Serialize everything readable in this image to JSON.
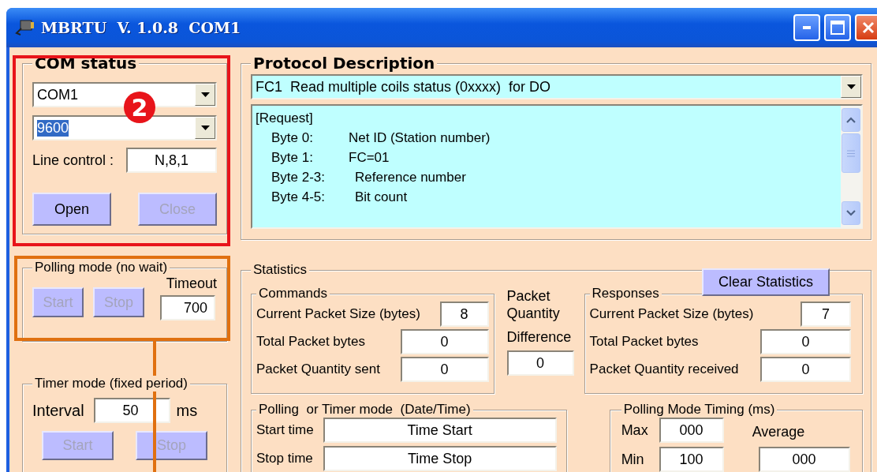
{
  "window": {
    "title": "MBRTU  V. 1.0.8  COM1"
  },
  "com_status": {
    "title": "COM status",
    "port": {
      "value": "COM1"
    },
    "baud": {
      "value": "9600",
      "text_selected": true
    },
    "line_control": {
      "label": "Line control :",
      "value": "N,8,1"
    },
    "buttons": [
      {
        "label": "Open",
        "disabled": false
      },
      {
        "label": "Close",
        "disabled": true
      }
    ]
  },
  "polling_mode": {
    "title": "Polling mode (no wait)",
    "buttons": [
      {
        "label": "Start",
        "disabled": true
      },
      {
        "label": "Stop",
        "disabled": true
      }
    ],
    "timeout": {
      "label": "Timeout",
      "value": "700"
    }
  },
  "timer_mode": {
    "title": "Timer mode (fixed period)",
    "interval": {
      "label": "Interval",
      "value": "50",
      "unit": "ms"
    },
    "buttons": [
      {
        "label": "Start",
        "disabled": true
      },
      {
        "label": "Stop",
        "disabled": true
      }
    ]
  },
  "protocol_description": {
    "title": "Protocol Description",
    "function_code": "FC1  Read multiple coils status (0xxxx)  for DO",
    "request_lines": [
      {
        "label": "[Request]"
      },
      {
        "label": "Byte 0:",
        "value": "Net ID (Station number)"
      },
      {
        "label": "Byte 1:",
        "value": "FC=01"
      },
      {
        "label": "Byte 2-3:",
        "value": "Reference number"
      },
      {
        "label": "Byte 4-5:",
        "value": "Bit count"
      }
    ]
  },
  "statistics": {
    "title": "Statistics",
    "clear_button": "Clear Statistics",
    "commands": {
      "title": "Commands",
      "rows": [
        {
          "label": "Current Packet Size (bytes)",
          "value": "8"
        },
        {
          "label": "Total Packet bytes",
          "value": "0"
        },
        {
          "label": "Packet Quantity sent",
          "value": "0"
        }
      ]
    },
    "difference": {
      "label_lines": [
        "Packet",
        "Quantity",
        "Difference"
      ],
      "value": "0"
    },
    "responses": {
      "title": "Responses",
      "rows": [
        {
          "label": "Current Packet Size (bytes)",
          "value": "7"
        },
        {
          "label": "Total Packet bytes",
          "value": "0"
        },
        {
          "label": "Packet Quantity received",
          "value": "0"
        }
      ]
    },
    "date_time": {
      "title": "Polling  or Timer mode  (Date/Time)",
      "rows": [
        {
          "label": "Start time",
          "value": "Time Start"
        },
        {
          "label": "Stop time",
          "value": "Time Stop"
        }
      ]
    },
    "timing": {
      "title": "Polling Mode Timing (ms)",
      "max": {
        "label": "Max",
        "value": "000"
      },
      "min": {
        "label": "Min",
        "value": "100"
      },
      "average": {
        "label": "Average",
        "value": "000"
      }
    }
  },
  "annotations": [
    {
      "kind": "badge",
      "text": "2"
    }
  ]
}
